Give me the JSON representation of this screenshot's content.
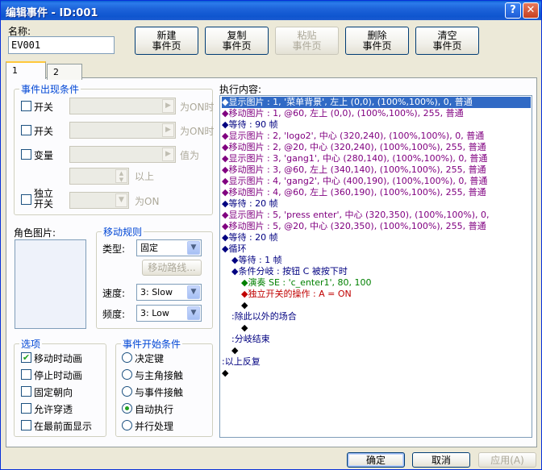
{
  "window": {
    "title": "编辑事件 - ID:001",
    "help_btn": "?",
    "close_btn": "✕"
  },
  "top": {
    "name_label": "名称:",
    "name_value": "EV001",
    "buttons": [
      {
        "l1": "新建",
        "l2": "事件页",
        "disabled": false
      },
      {
        "l1": "复制",
        "l2": "事件页",
        "disabled": false
      },
      {
        "l1": "粘贴",
        "l2": "事件页",
        "disabled": true
      },
      {
        "l1": "删除",
        "l2": "事件页",
        "disabled": false
      },
      {
        "l1": "清空",
        "l2": "事件页",
        "disabled": false
      }
    ]
  },
  "tabs": [
    "1",
    "2"
  ],
  "conditions": {
    "title": "事件出现条件",
    "switch1": "开关",
    "switch1_suffix": "为ON时",
    "switch2": "开关",
    "switch2_suffix": "为ON时",
    "variable": "变量",
    "variable_suffix": "值为",
    "above": "以上",
    "self_switch_l1": "独立",
    "self_switch_l2": "开关",
    "self_suffix": "为ON"
  },
  "graphic": {
    "label": "角色图片:"
  },
  "move": {
    "title": "移动规则",
    "type_label": "类型:",
    "type_value": "固定",
    "route_btn": "移动路线...",
    "speed_label": "速度:",
    "speed_value": "3: Slow",
    "freq_label": "频度:",
    "freq_value": "3: Low"
  },
  "options": {
    "title": "选项",
    "items": [
      {
        "label": "移动时动画",
        "checked": true
      },
      {
        "label": "停止时动画",
        "checked": false
      },
      {
        "label": "固定朝向",
        "checked": false
      },
      {
        "label": "允许穿透",
        "checked": false
      },
      {
        "label": "在最前面显示",
        "checked": false
      }
    ]
  },
  "trigger": {
    "title": "事件开始条件",
    "items": [
      {
        "label": "决定键",
        "selected": false
      },
      {
        "label": "与主角接触",
        "selected": false
      },
      {
        "label": "与事件接触",
        "selected": false
      },
      {
        "label": "自动执行",
        "selected": true
      },
      {
        "label": "并行处理",
        "selected": false
      }
    ]
  },
  "commands": {
    "label": "执行内容:",
    "lines": [
      {
        "indent": 0,
        "color": "purple",
        "text": "◆显示图片 : 1, '菜单背景', 左上 (0,0), (100%,100%), 0, 普通"
      },
      {
        "indent": 0,
        "color": "purple",
        "text": "◆移动图片 : 1, @60, 左上 (0,0), (100%,100%), 255, 普通"
      },
      {
        "indent": 0,
        "color": "navy",
        "text": "◆等待 : 90 帧"
      },
      {
        "indent": 0,
        "color": "purple",
        "text": "◆显示图片 : 2, 'logo2', 中心 (320,240), (100%,100%), 0, 普通"
      },
      {
        "indent": 0,
        "color": "purple",
        "text": "◆移动图片 : 2, @20, 中心 (320,240), (100%,100%), 255, 普通"
      },
      {
        "indent": 0,
        "color": "purple",
        "text": "◆显示图片 : 3, 'gang1', 中心 (280,140), (100%,100%), 0, 普通"
      },
      {
        "indent": 0,
        "color": "purple",
        "text": "◆移动图片 : 3, @60, 左上 (340,140), (100%,100%), 255, 普通"
      },
      {
        "indent": 0,
        "color": "purple",
        "text": "◆显示图片 : 4, 'gang2', 中心 (400,190), (100%,100%), 0, 普通"
      },
      {
        "indent": 0,
        "color": "purple",
        "text": "◆移动图片 : 4, @60, 左上 (360,190), (100%,100%), 255, 普通"
      },
      {
        "indent": 0,
        "color": "navy",
        "text": "◆等待 : 20 帧"
      },
      {
        "indent": 0,
        "color": "purple",
        "text": "◆显示图片 : 5, 'press enter', 中心 (320,350), (100%,100%), 0,"
      },
      {
        "indent": 0,
        "color": "purple",
        "text": "◆移动图片 : 5, @20, 中心 (320,350), (100%,100%), 255, 普通"
      },
      {
        "indent": 0,
        "color": "navy",
        "text": "◆等待 : 20 帧"
      },
      {
        "indent": 0,
        "color": "navy",
        "text": "◆循环"
      },
      {
        "indent": 1,
        "color": "navy",
        "text": "◆等待 : 1 帧"
      },
      {
        "indent": 1,
        "color": "navy",
        "text": "◆条件分岐 : 按钮 C 被按下时"
      },
      {
        "indent": 2,
        "color": "green",
        "text": "◆演奏 SE : 'c_enter1', 80, 100"
      },
      {
        "indent": 2,
        "color": "red",
        "text": "◆独立开关的操作 : A = ON"
      },
      {
        "indent": 2,
        "color": "black",
        "text": "◆"
      },
      {
        "indent": 1,
        "color": "navy",
        "text": ":除此以外的场合"
      },
      {
        "indent": 2,
        "color": "black",
        "text": "◆"
      },
      {
        "indent": 1,
        "color": "navy",
        "text": ":分岐结束"
      },
      {
        "indent": 1,
        "color": "black",
        "text": "◆"
      },
      {
        "indent": 0,
        "color": "navy",
        "text": ":以上反复"
      },
      {
        "indent": 0,
        "color": "black",
        "text": "◆"
      }
    ]
  },
  "footer": {
    "ok": "确定",
    "cancel": "取消",
    "apply": "应用(A)"
  }
}
